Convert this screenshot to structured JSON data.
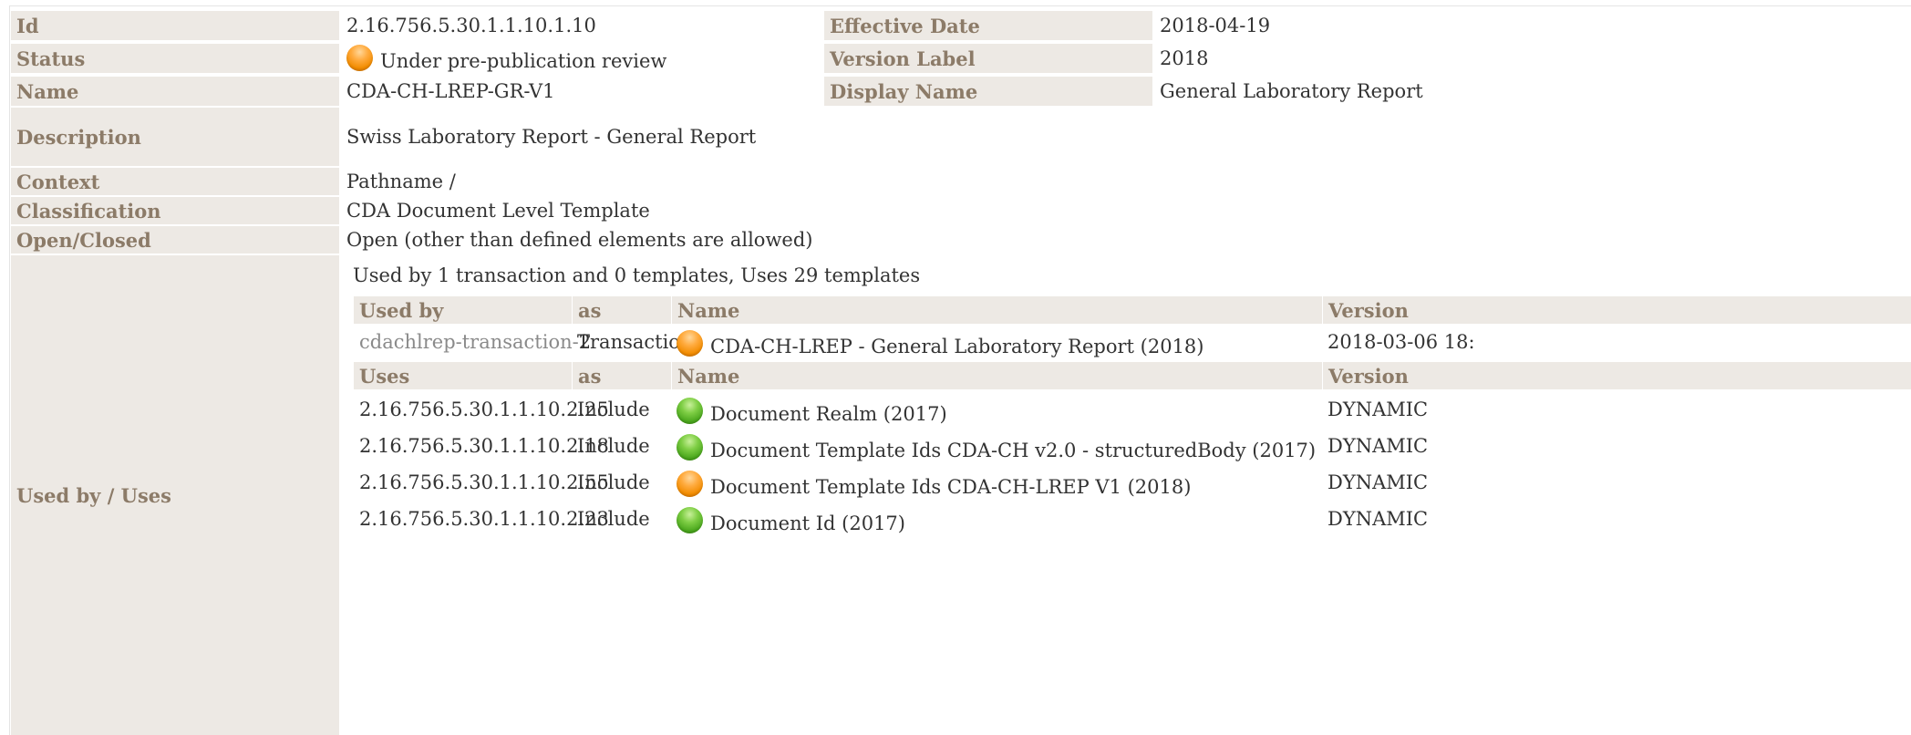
{
  "colors": {
    "label_bg": "#ede9e4",
    "label_text": "#8c7b68",
    "value_text": "#333333",
    "status_orange": "#f28c00",
    "status_green": "#4aa71d"
  },
  "template": {
    "id": {
      "label": "Id",
      "value": "2.16.756.5.30.1.1.10.1.10"
    },
    "effective_date": {
      "label": "Effective Date",
      "value": "2018-04-19"
    },
    "status": {
      "label": "Status",
      "value": "Under pre-publication review",
      "icon": "status-orange-icon"
    },
    "version_label": {
      "label": "Version Label",
      "value": "2018"
    },
    "name": {
      "label": "Name",
      "value": "CDA-CH-LREP-GR-V1"
    },
    "display_name": {
      "label": "Display Name",
      "value": "General Laboratory Report"
    },
    "description": {
      "label": "Description",
      "value": "Swiss Laboratory Report - General Report"
    },
    "context": {
      "label": "Context",
      "value": "Pathname /"
    },
    "classification": {
      "label": "Classification",
      "value": "CDA Document Level Template"
    },
    "open_closed": {
      "label": "Open/Closed",
      "value": "Open (other than defined elements are allowed)"
    },
    "used_by_uses": {
      "label": "Used by / Uses",
      "summary": "Used by 1 transaction and 0 templates, Uses 29 templates",
      "used_by_headers": {
        "col1": "Used by",
        "col2": "as",
        "col3": "Name",
        "col4": "Version"
      },
      "used_by_rows": [
        {
          "ref_prefix": "cdachlrep-transaction-",
          "ref_suffix": "2",
          "as": "Transaction",
          "icon": "status-orange-icon",
          "name": "CDA-CH-LREP - General Laboratory Report (2018)",
          "version": "2018-03-06 18:"
        }
      ],
      "uses_headers": {
        "col1": "Uses",
        "col2": "as",
        "col3": "Name",
        "col4": "Version"
      },
      "uses_rows": [
        {
          "id": "2.16.756.5.30.1.1.10.2.25",
          "as": "Include",
          "icon": "status-green-icon",
          "name": "Document Realm (2017)",
          "version": "DYNAMIC"
        },
        {
          "id": "2.16.756.5.30.1.1.10.2.18",
          "as": "Include",
          "icon": "status-green-icon",
          "name": "Document Template Ids CDA-CH v2.0 - structuredBody (2017)",
          "version": "DYNAMIC"
        },
        {
          "id": "2.16.756.5.30.1.1.10.2.55",
          "as": "Include",
          "icon": "status-orange-icon",
          "name": "Document Template Ids CDA-CH-LREP V1 (2018)",
          "version": "DYNAMIC"
        },
        {
          "id": "2.16.756.5.30.1.1.10.2.23",
          "as": "Include",
          "icon": "status-green-icon",
          "name": "Document Id (2017)",
          "version": "DYNAMIC"
        }
      ]
    }
  }
}
